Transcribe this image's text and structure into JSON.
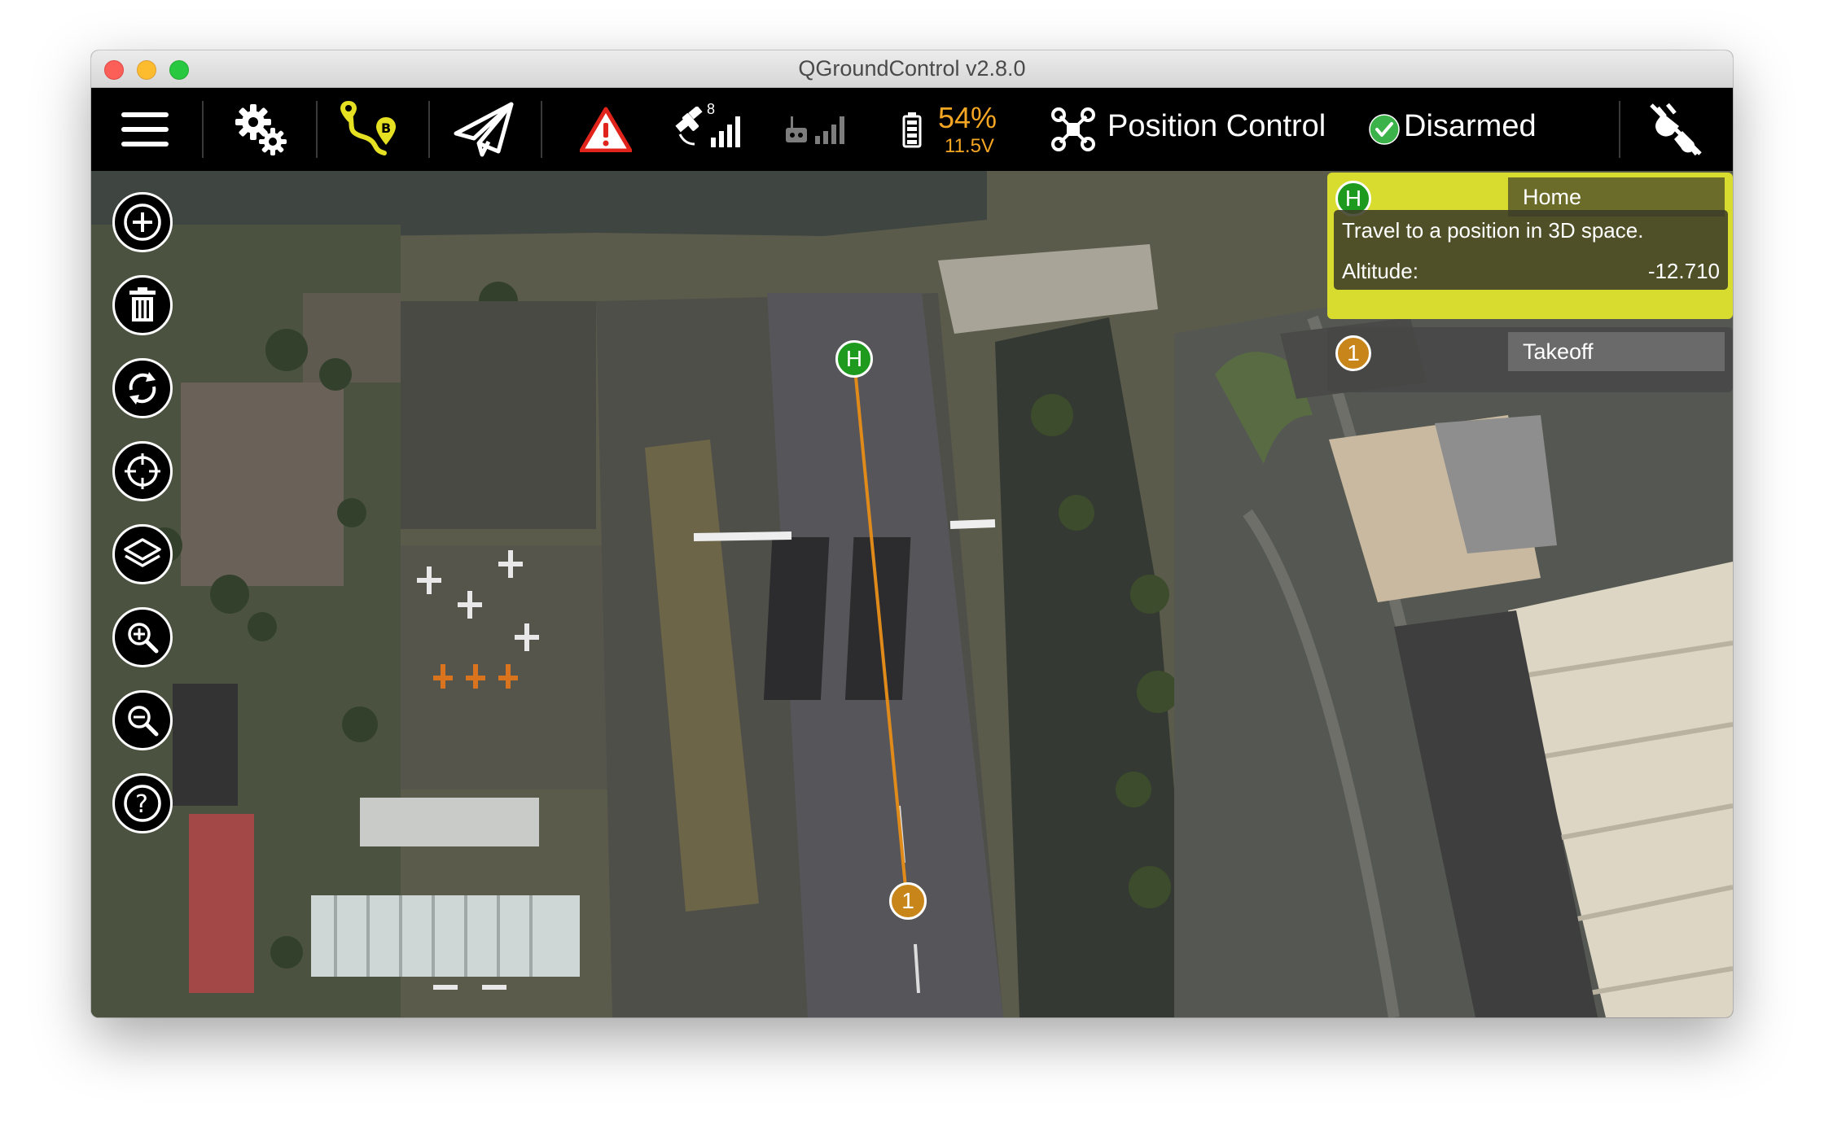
{
  "window": {
    "title": "QGroundControl v2.8.0"
  },
  "toolbar": {
    "satellite_count": "8",
    "battery_percent": "54%",
    "battery_voltage": "11.5V",
    "flight_mode": "Position Control",
    "arm_state": "Disarmed",
    "icons": [
      "menu-icon",
      "settings-gears-icon",
      "plan-route-icon",
      "fly-paper-plane-icon",
      "warning-icon",
      "gps-satellite-icon",
      "rc-signal-icon",
      "battery-icon",
      "quadcopter-icon",
      "check-circle-icon",
      "disconnect-plug-icon"
    ]
  },
  "colors": {
    "accent_yellow": "#d8dc2e",
    "battery_orange": "#f5a623",
    "home_green": "#1e9a1e",
    "waypoint_orange": "#c8851a",
    "route_line": "#e08a1a"
  },
  "map_tools": [
    "add-waypoint-icon",
    "delete-icon",
    "sync-icon",
    "center-crosshair-icon",
    "map-layers-icon",
    "zoom-in-icon",
    "zoom-out-icon",
    "help-icon"
  ],
  "map_markers": {
    "home_label": "H",
    "waypoint_1_label": "1"
  },
  "mission": {
    "items": [
      {
        "badge": "H",
        "command": "Home",
        "description": "Travel to a position in 3D space.",
        "altitude_label": "Altitude:",
        "altitude_value": "-12.710"
      },
      {
        "badge": "1",
        "command": "Takeoff"
      }
    ]
  }
}
